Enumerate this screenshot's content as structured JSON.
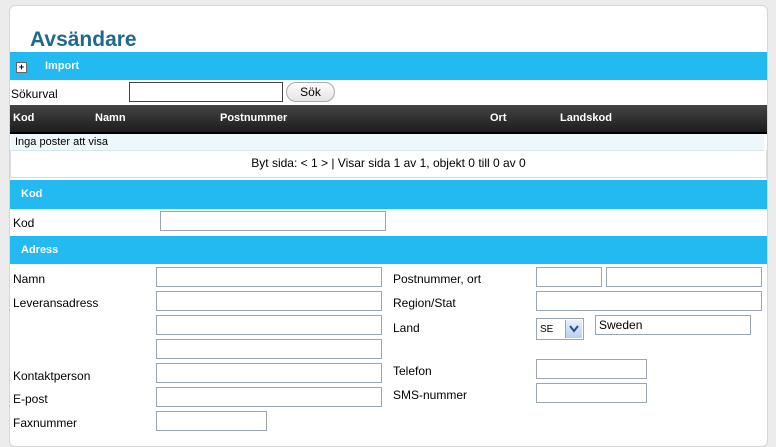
{
  "page": {
    "title": "Avsändare"
  },
  "import": {
    "label": "Import",
    "expand_symbol": "+"
  },
  "search": {
    "label": "Sökurval",
    "value": "",
    "button": "Sök"
  },
  "table": {
    "columns": [
      "Kod",
      "Namn",
      "Postnummer",
      "Ort",
      "Landskod"
    ],
    "empty_text": "Inga poster att visa",
    "pager_text": "Byt sida: < 1 > | Visar sida 1 av 1, objekt 0 till 0 av 0"
  },
  "kod_section": {
    "header": "Kod",
    "field_label": "Kod",
    "value": ""
  },
  "address": {
    "header": "Adress",
    "namn": {
      "label": "Namn",
      "value": ""
    },
    "leveransadress": {
      "label": "Leveransadress",
      "lines": [
        "",
        "",
        ""
      ]
    },
    "kontaktperson": {
      "label": "Kontaktperson",
      "value": ""
    },
    "epost": {
      "label": "E-post",
      "value": ""
    },
    "faxnummer": {
      "label": "Faxnummer",
      "value": ""
    },
    "postnummer_ort": {
      "label": "Postnummer, ort",
      "postnummer": "",
      "ort": ""
    },
    "region": {
      "label": "Region/Stat",
      "value": ""
    },
    "land": {
      "label": "Land",
      "code": "SE",
      "name": "Sweden"
    },
    "telefon": {
      "label": "Telefon",
      "value": ""
    },
    "sms": {
      "label": "SMS-nummer",
      "value": ""
    }
  },
  "colors": {
    "accent": "#22baf0",
    "title": "#1f6a8c"
  }
}
